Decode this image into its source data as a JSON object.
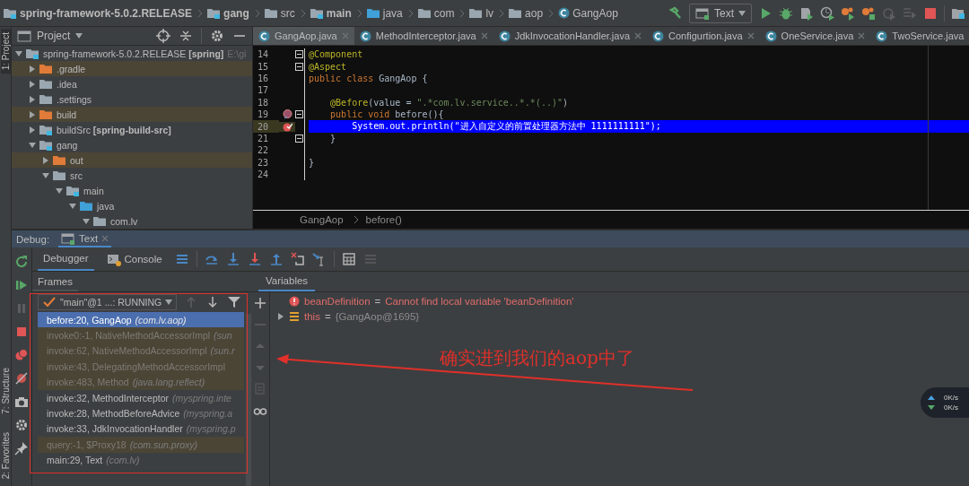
{
  "breadcrumbs": [
    {
      "label": "spring-framework-5.0.2.RELEASE",
      "kind": "module"
    },
    {
      "label": "gang",
      "kind": "module"
    },
    {
      "label": "src",
      "kind": "folder"
    },
    {
      "label": "main",
      "kind": "module"
    },
    {
      "label": "java",
      "kind": "source"
    },
    {
      "label": "com",
      "kind": "package"
    },
    {
      "label": "lv",
      "kind": "package"
    },
    {
      "label": "aop",
      "kind": "package"
    },
    {
      "label": "GangAop",
      "kind": "class"
    }
  ],
  "run_config": {
    "label": "Text"
  },
  "tool_windows_top": [
    {
      "label": "1: Project",
      "selected": true
    }
  ],
  "tool_windows_bottom": [
    {
      "label": "7: Structure",
      "selected": false
    },
    {
      "label": "2: Favorites",
      "selected": false
    }
  ],
  "project_panel": {
    "title": "Project",
    "tree": [
      {
        "label": "spring-framework-5.0.2.RELEASE **[spring]**",
        "path": "E:\\gi",
        "kind": "module",
        "expanded": true,
        "children": [
          {
            "label": ".gradle",
            "kind": "excluded",
            "expanded": false
          },
          {
            "label": ".idea",
            "kind": "folder",
            "expanded": false
          },
          {
            "label": ".settings",
            "kind": "folder",
            "expanded": false
          },
          {
            "label": "build",
            "kind": "excluded",
            "expanded": false
          },
          {
            "label": "buildSrc **[spring-build-src]**",
            "kind": "module",
            "expanded": false
          },
          {
            "label": "gang",
            "kind": "module",
            "expanded": true,
            "children": [
              {
                "label": "out",
                "kind": "excluded",
                "expanded": false
              },
              {
                "label": "src",
                "kind": "folder",
                "expanded": true,
                "children": [
                  {
                    "label": "main",
                    "kind": "module",
                    "expanded": true,
                    "children": [
                      {
                        "label": "java",
                        "kind": "source",
                        "expanded": true,
                        "children": [
                          {
                            "label": "com.lv",
                            "kind": "package",
                            "expanded": true
                          }
                        ]
                      }
                    ]
                  }
                ]
              }
            ]
          }
        ]
      }
    ]
  },
  "editor": {
    "tabs": [
      {
        "label": "GangAop.java",
        "selected": true
      },
      {
        "label": "MethodInterceptor.java",
        "selected": false
      },
      {
        "label": "JdkInvocationHandler.java",
        "selected": false
      },
      {
        "label": "Configurtion.java",
        "selected": false
      },
      {
        "label": "OneService.java",
        "selected": false
      },
      {
        "label": "TwoService.java",
        "selected": false
      }
    ],
    "lines": [
      {
        "number": "14",
        "fold": true,
        "kind": "plain",
        "current": false,
        "segments": [
          {
            "kind": "annotation",
            "text": "@Component"
          }
        ]
      },
      {
        "number": "15",
        "fold": true,
        "kind": "plain",
        "current": false,
        "segments": [
          {
            "kind": "annotation",
            "text": "@Aspect"
          }
        ]
      },
      {
        "number": "16",
        "fold": false,
        "kind": "plain",
        "current": false,
        "segments": [
          {
            "kind": "keyword",
            "text": "public class"
          },
          {
            "kind": "plain",
            "text": " GangAop {"
          }
        ]
      },
      {
        "number": "17",
        "fold": false,
        "kind": "plain",
        "current": false
      },
      {
        "number": "18",
        "fold": false,
        "kind": "plain",
        "current": false,
        "segments": [
          {
            "kind": "annotation",
            "text": "    @Before"
          },
          {
            "kind": "plain",
            "text": "(value = "
          },
          {
            "kind": "string",
            "text": "\".*com.lv.service..*.*(..)\""
          },
          {
            "kind": "plain",
            "text": ")"
          }
        ]
      },
      {
        "number": "19",
        "fold": true,
        "kind": "method-breakpoint",
        "current": false,
        "segments": [
          {
            "kind": "keyword",
            "text": "    public void"
          },
          {
            "kind": "plain",
            "text": " before(){"
          }
        ]
      },
      {
        "number": "20",
        "fold": false,
        "kind": "breakpoint-hit",
        "current": true,
        "segments": [
          {
            "kind": "plain",
            "text": "        System.out.println("
          },
          {
            "kind": "string",
            "text": "\"进入自定义的前置处理器方法中 1111111111\""
          },
          {
            "kind": "plain",
            "text": ");"
          }
        ]
      },
      {
        "number": "21",
        "fold": true,
        "kind": "plain",
        "current": false,
        "segments": [
          {
            "kind": "plain",
            "text": "    }"
          }
        ]
      },
      {
        "number": "22",
        "fold": false,
        "kind": "plain",
        "current": false
      },
      {
        "number": "23",
        "fold": false,
        "kind": "plain",
        "current": false,
        "segments": [
          {
            "kind": "plain",
            "text": "}"
          }
        ]
      },
      {
        "number": "24",
        "fold": false,
        "kind": "plain",
        "current": false
      }
    ],
    "breadcrumb": [
      "GangAop",
      "before()"
    ]
  },
  "debug": {
    "title": "Debug:",
    "session_tab": {
      "label": "Text"
    },
    "tabs": [
      {
        "label": "Debugger",
        "selected": true
      },
      {
        "label": "Console",
        "selected": false
      }
    ],
    "frames_title": "Frames",
    "variables_title": "Variables",
    "thread": "\"main\"@1 ...: RUNNING",
    "frames": [
      {
        "method": "before:20, GangAop",
        "package": "(com.lv.aop)",
        "selected": true,
        "library": false
      },
      {
        "method": "invoke0:-1, NativeMethodAccessorImpl",
        "package": "(sun",
        "selected": false,
        "library": true
      },
      {
        "method": "invoke:62, NativeMethodAccessorImpl",
        "package": "(sun.r",
        "selected": false,
        "library": true
      },
      {
        "method": "invoke:43, DelegatingMethodAccessorImpl",
        "selected": false,
        "library": true
      },
      {
        "method": "invoke:483, Method",
        "package": "(java.lang.reflect)",
        "selected": false,
        "library": true
      },
      {
        "method": "invoke:32, MethodInterceptor",
        "package": "(myspring.inte",
        "selected": false,
        "library": false
      },
      {
        "method": "invoke:28, MethodBeforeAdvice",
        "package": "(myspring.a",
        "selected": false,
        "library": false
      },
      {
        "method": "invoke:33, JdkInvocationHandler",
        "package": "(myspring.p",
        "selected": false,
        "library": false
      },
      {
        "method": "query:-1, $Proxy18",
        "package": "(com.sun.proxy)",
        "selected": false,
        "library": true
      },
      {
        "method": "main:29, Text",
        "package": "(com.lv)",
        "selected": false,
        "library": false
      }
    ],
    "variables": [
      {
        "name": "beanDefinition",
        "operator": "=",
        "value": "Cannot find local variable 'beanDefinition'",
        "kind": "error"
      },
      {
        "name": "this",
        "operator": "=",
        "value": "{GangAop@1695}",
        "kind": "object",
        "expanded": false
      }
    ]
  },
  "annotation": {
    "text": "确实进到我们的aop中了"
  },
  "network_widget": {
    "upload": "0K/s",
    "download": "0K/s"
  }
}
